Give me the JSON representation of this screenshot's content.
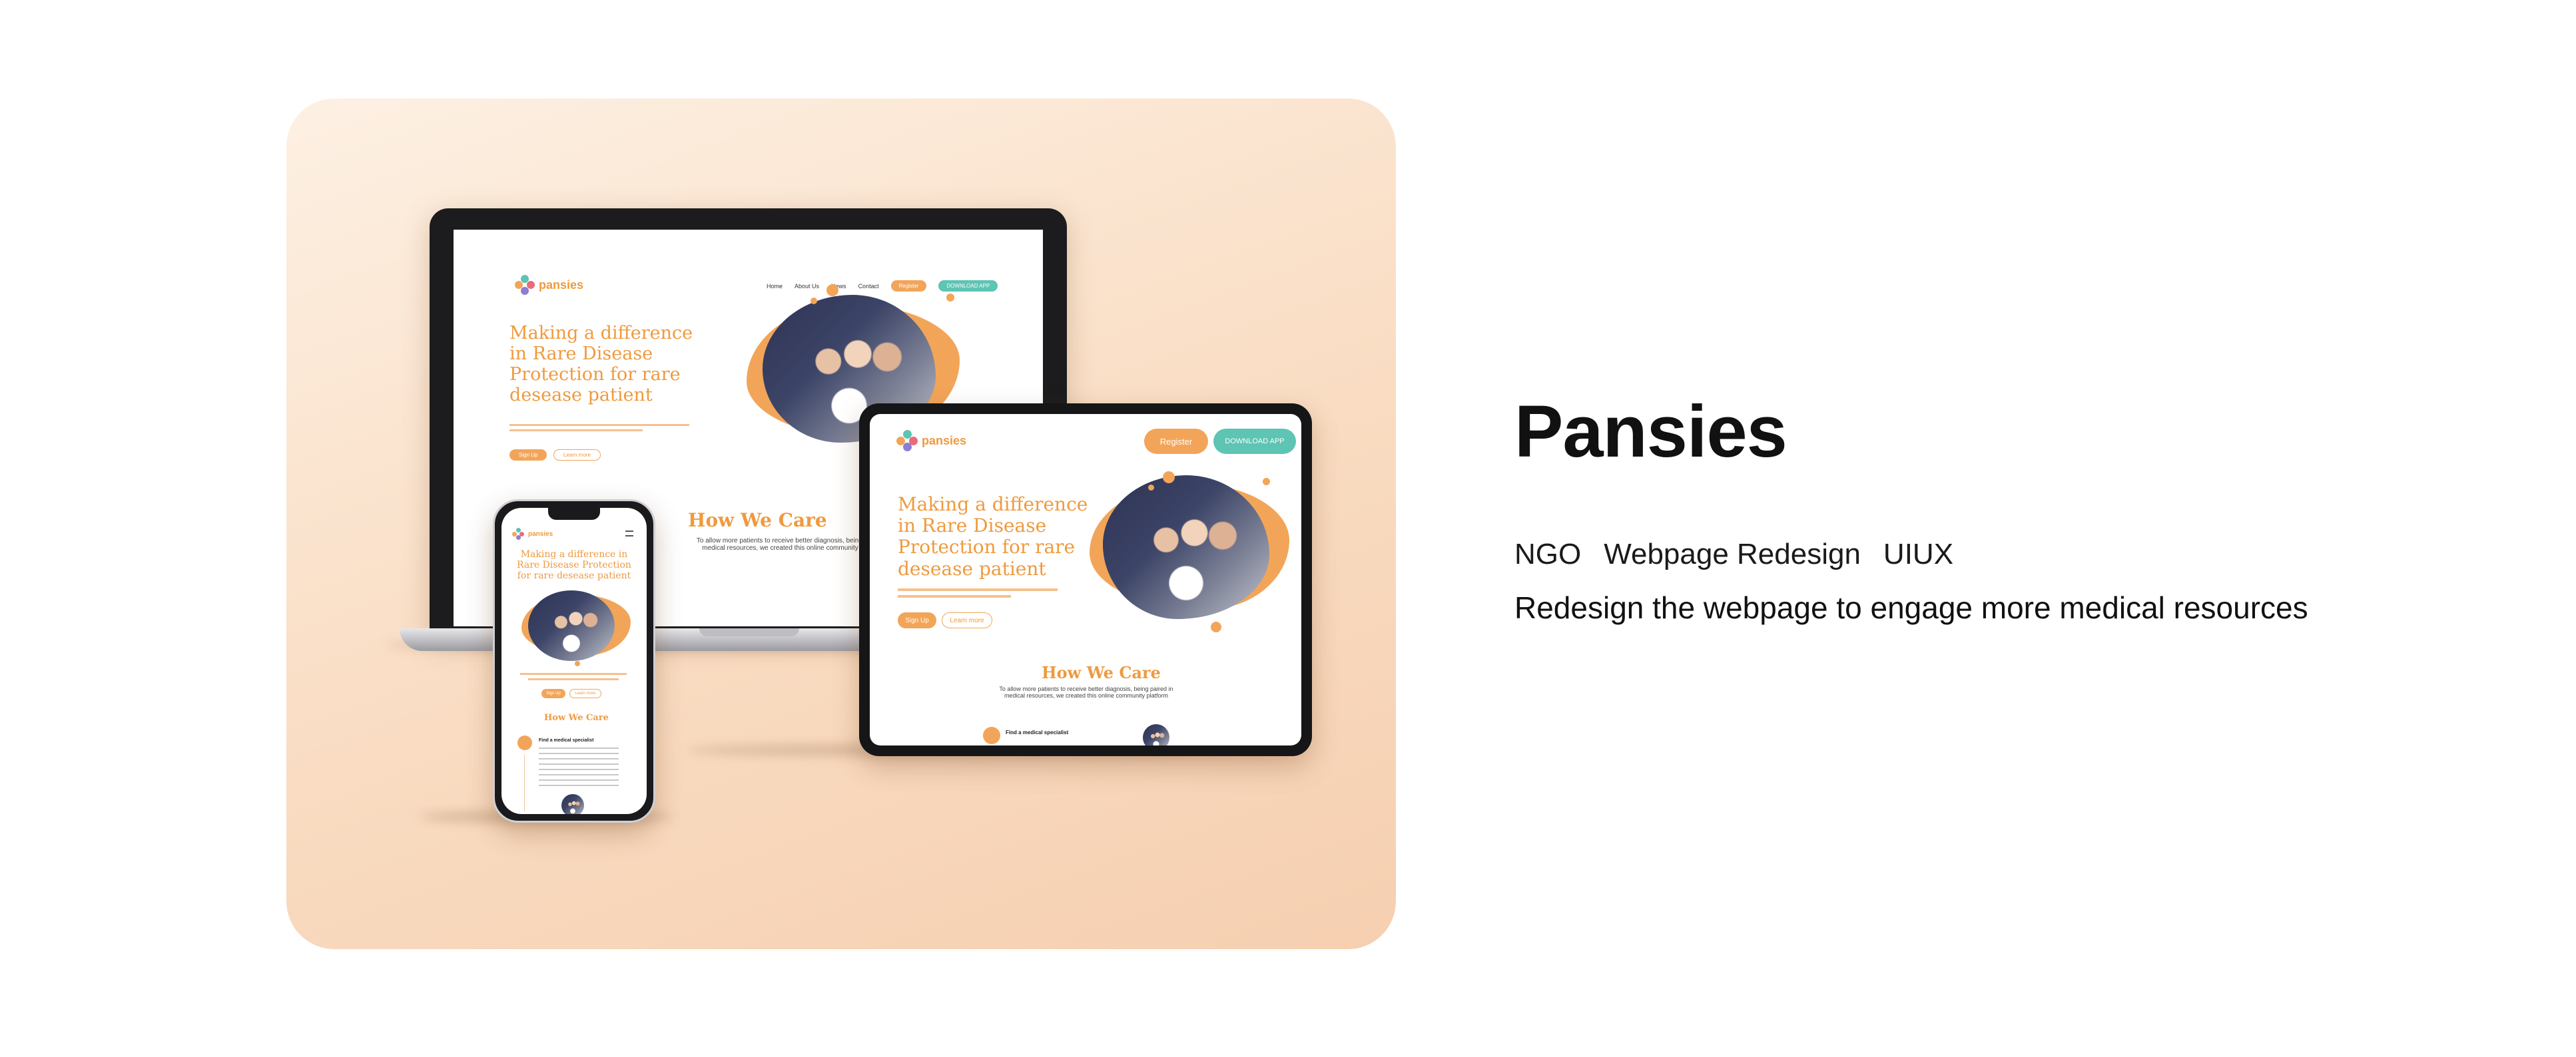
{
  "project": {
    "title": "Pansies",
    "tags": [
      "NGO",
      "Webpage Redesign",
      "UIUX"
    ],
    "description": "Redesign the webpage to engage more medical resources"
  },
  "mockup_site": {
    "logo_text": "pansies",
    "nav": [
      "Home",
      "About Us",
      "News",
      "Contact"
    ],
    "register_label": "Register",
    "download_label": "DOWNLOAD APP",
    "hero_title_lines": [
      "Making a difference",
      "in Rare Disease",
      "Protection for rare",
      "desease patient"
    ],
    "signup_label": "Sign Up",
    "learn_label": "Learn more",
    "section_title": "How We Care",
    "section_text_1": "To allow more patients to receive better diagnosis, being paired in",
    "section_text_2": "medical resources, we created this online community platform",
    "phone_hero_title": "Making a difference in Rare Disease Protection for rare desease patient",
    "phone_step_title": "Find a medical specialist"
  },
  "colors": {
    "accent_orange": "#f2a559",
    "accent_teal": "#5ec4b3",
    "card_bg": "#f9dcc2"
  }
}
